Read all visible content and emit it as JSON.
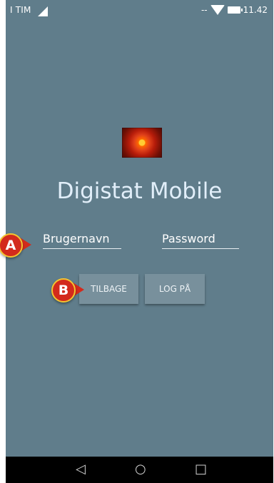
{
  "status_bar": {
    "carrier": "I TIM",
    "signal_dash": "--",
    "time": "11.42"
  },
  "app": {
    "title": "Digistat Mobile"
  },
  "login": {
    "username_placeholder": "Brugernavn",
    "password_placeholder": "Password",
    "back_label": "TILBAGE",
    "login_label": "LOG PÅ"
  },
  "navbar": {
    "back_icon": "◁",
    "home_icon": "○",
    "recent_icon": "□"
  },
  "annotations": {
    "marker_a": "A",
    "marker_b": "B"
  },
  "colors": {
    "screen_bg": "#607d8b",
    "button_bg": "#78909c",
    "marker_red": "#d32a1c",
    "marker_border": "#f3c531"
  }
}
